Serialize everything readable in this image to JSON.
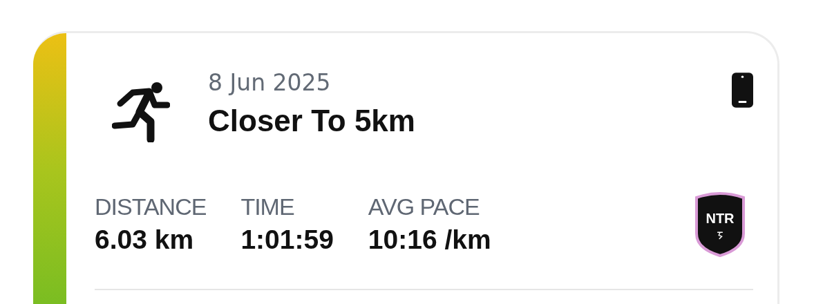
{
  "activity": {
    "date": "8 Jun 2025",
    "title": "Closer To 5km"
  },
  "stats": [
    {
      "label": "DISTANCE",
      "value": "6.03 km"
    },
    {
      "label": "TIME",
      "value": "1:01:59"
    },
    {
      "label": "AVG PACE",
      "value": "10:16 /km"
    }
  ],
  "badge": {
    "label": "NTR"
  }
}
